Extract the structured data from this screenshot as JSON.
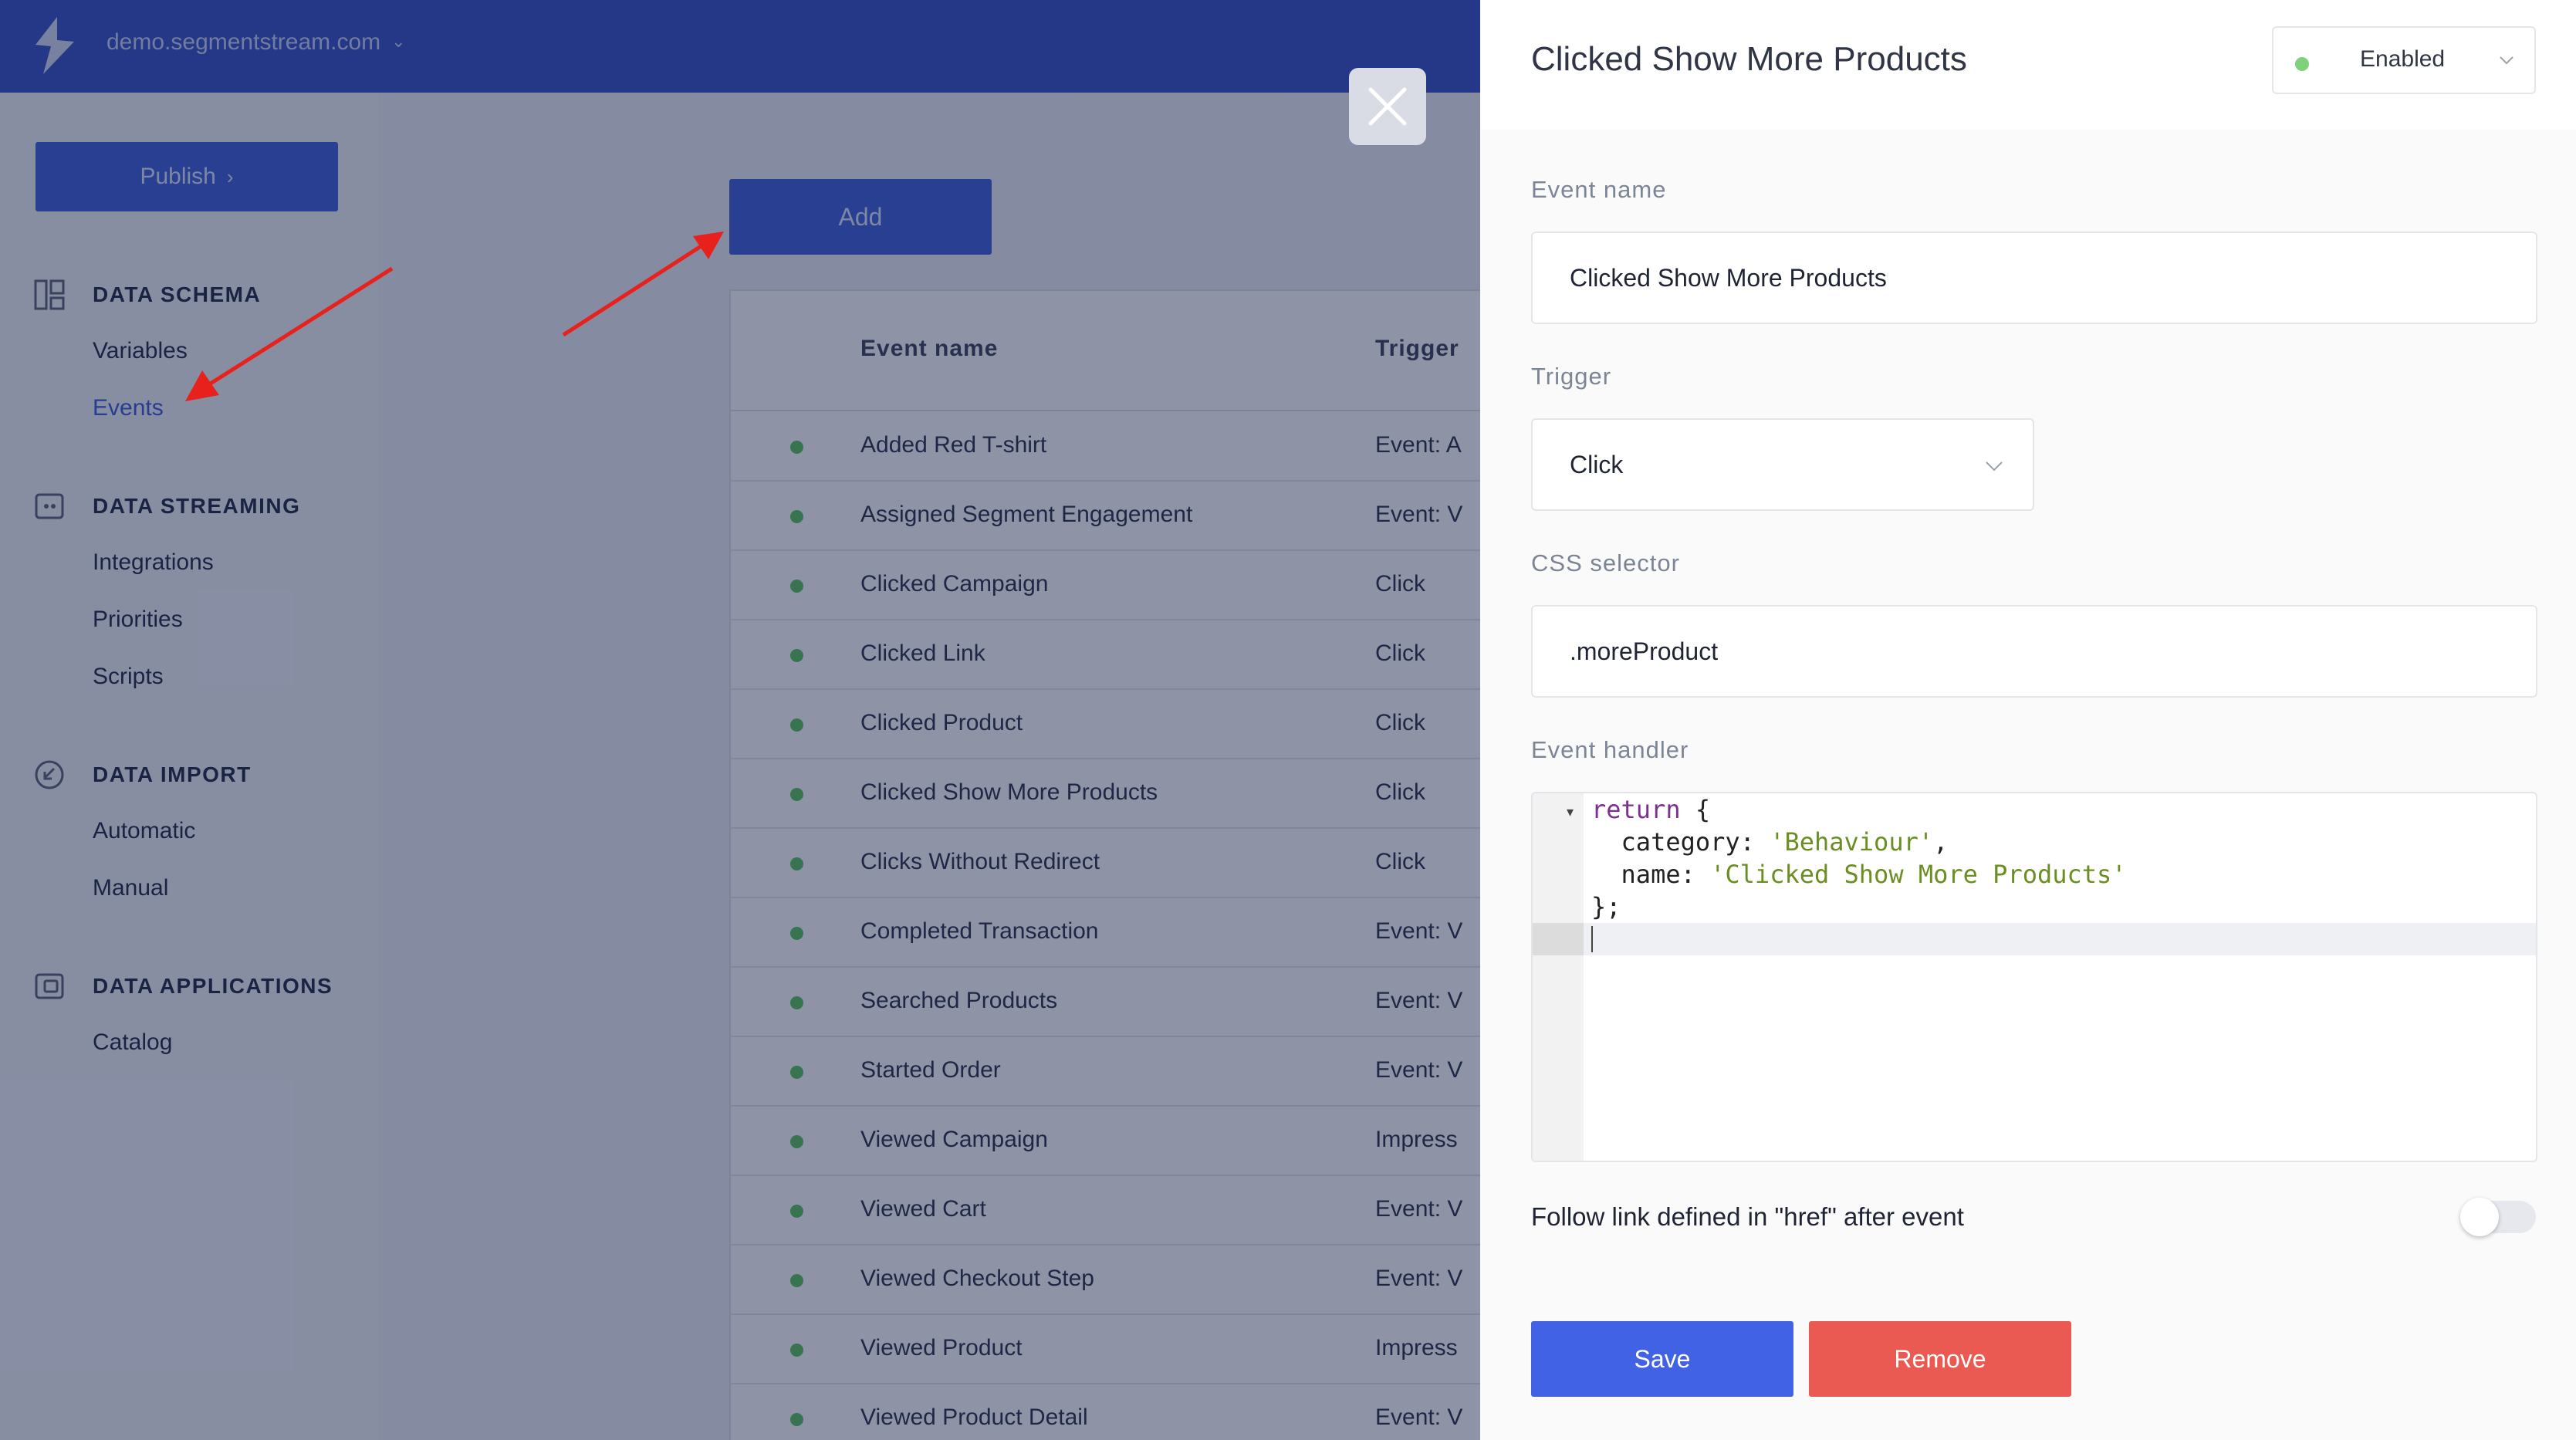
{
  "topbar": {
    "domain": "demo.segmentstream.com"
  },
  "sidebar": {
    "publish_label": "Publish",
    "sections": [
      {
        "title": "DATA SCHEMA",
        "icon": "schema-icon",
        "items": [
          "Variables",
          "Events"
        ]
      },
      {
        "title": "DATA STREAMING",
        "icon": "streaming-icon",
        "items": [
          "Integrations",
          "Priorities",
          "Scripts"
        ]
      },
      {
        "title": "DATA IMPORT",
        "icon": "import-icon",
        "items": [
          "Automatic",
          "Manual"
        ]
      },
      {
        "title": "DATA APPLICATIONS",
        "icon": "applications-icon",
        "items": [
          "Catalog"
        ]
      }
    ],
    "active_item": "Events"
  },
  "main": {
    "add_label": "Add",
    "columns": [
      "Event name",
      "Trigger"
    ],
    "rows": [
      {
        "name": "Added Red T-shirt",
        "trigger": "Event: A"
      },
      {
        "name": "Assigned Segment Engagement",
        "trigger": "Event: V"
      },
      {
        "name": "Clicked Campaign",
        "trigger": "Click"
      },
      {
        "name": "Clicked Link",
        "trigger": "Click"
      },
      {
        "name": "Clicked Product",
        "trigger": "Click"
      },
      {
        "name": "Clicked Show More Products",
        "trigger": "Click"
      },
      {
        "name": "Clicks Without Redirect",
        "trigger": "Click"
      },
      {
        "name": "Completed Transaction",
        "trigger": "Event: V"
      },
      {
        "name": "Searched Products",
        "trigger": "Event: V"
      },
      {
        "name": "Started Order",
        "trigger": "Event: V"
      },
      {
        "name": "Viewed Campaign",
        "trigger": "Impress"
      },
      {
        "name": "Viewed Cart",
        "trigger": "Event: V"
      },
      {
        "name": "Viewed Checkout Step",
        "trigger": "Event: V"
      },
      {
        "name": "Viewed Product",
        "trigger": "Impress"
      },
      {
        "name": "Viewed Product Detail",
        "trigger": "Event: V"
      }
    ]
  },
  "panel": {
    "title": "Clicked Show More Products",
    "status": "Enabled",
    "event_name_label": "Event name",
    "event_name_value": "Clicked Show More Products",
    "trigger_label": "Trigger",
    "trigger_value": "Click",
    "css_selector_label": "CSS selector",
    "css_selector_value": ".moreProduct",
    "event_handler_label": "Event handler",
    "code": {
      "line1_kw": "return",
      "line1_rest": " {",
      "line2_key": "  category: ",
      "line2_str": "'Behaviour'",
      "line2_end": ",",
      "line3_key": "  name: ",
      "line3_str": "'Clicked Show More Products'",
      "line4": "};"
    },
    "follow_link_label": "Follow link defined in \"href\" after event",
    "follow_link_enabled": false,
    "save_label": "Save",
    "remove_label": "Remove"
  },
  "colors": {
    "primary": "#3e5fd9",
    "save": "#4262e6",
    "remove": "#ea5a52",
    "status_dot": "#5cc35d",
    "annotation_arrow": "#e8211d"
  }
}
